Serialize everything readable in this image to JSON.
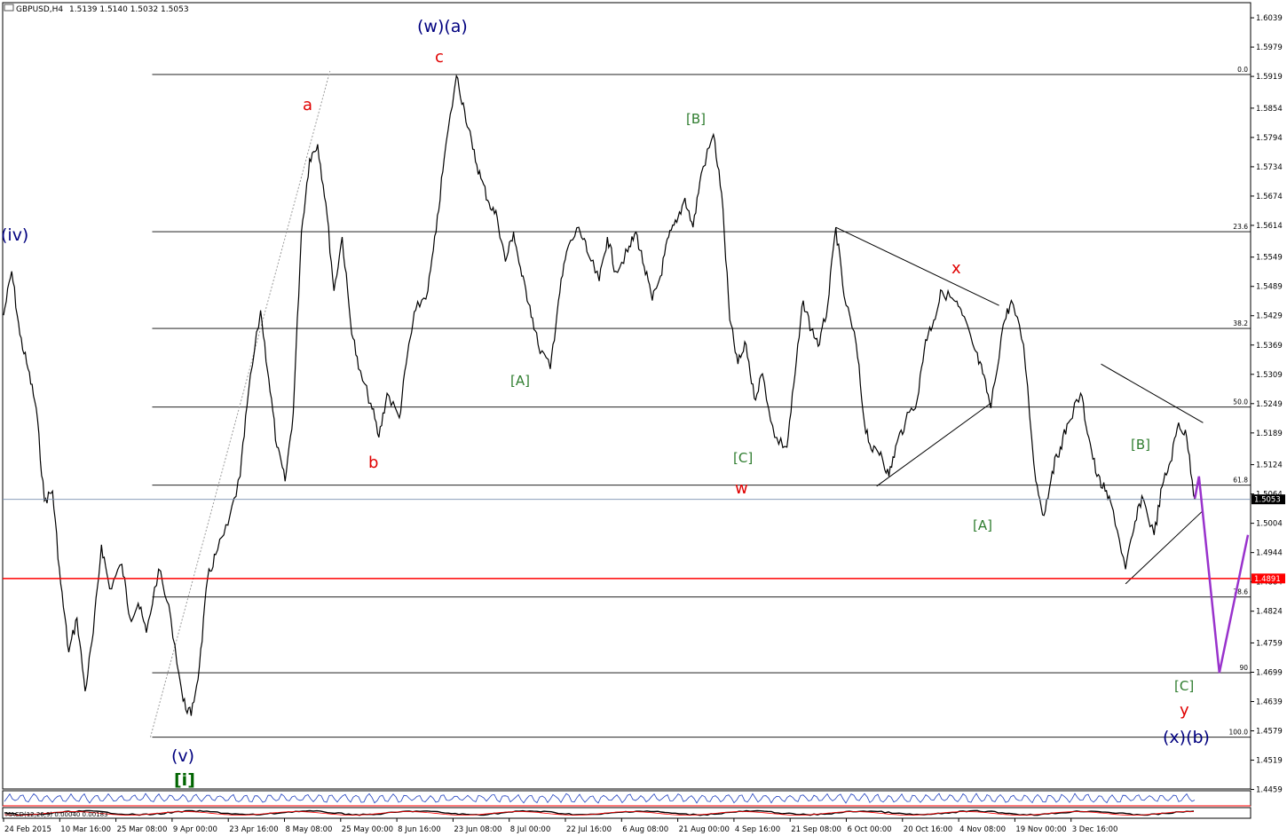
{
  "header": {
    "symbol": "GBPUSD,H4",
    "ohlc": "1.5139 1.5140 1.5032 1.5053"
  },
  "colors": {
    "price": "#000000",
    "projection": "#9932cc",
    "support": "#ff0000",
    "wave_blue": "#00007f",
    "wave_red": "#e00000",
    "wave_green": "#2f7d2f"
  },
  "chart_data": {
    "type": "line",
    "title": "GBPUSD,H4",
    "ylim": [
      1.446,
      1.607
    ],
    "y_ticks": [
      "1.6039",
      "1.5979",
      "1.5919",
      "1.5854",
      "1.5794",
      "1.5734",
      "1.5674",
      "1.5614",
      "1.5549",
      "1.5489",
      "1.5429",
      "1.5369",
      "1.5309",
      "1.5249",
      "1.5189",
      "1.5124",
      "1.5064",
      "1.5004",
      "1.4944",
      "1.4884",
      "1.4824",
      "1.4759",
      "1.4699",
      "1.4639",
      "1.4579",
      "1.4519",
      "1.4459"
    ],
    "x_ticks": [
      "24 Feb 2015",
      "10 Mar 16:00",
      "25 Mar 08:00",
      "9 Apr 00:00",
      "23 Apr 16:00",
      "8 May 08:00",
      "25 May 00:00",
      "8 Jun 16:00",
      "23 Jun 08:00",
      "8 Jul 00:00",
      "22 Jul 16:00",
      "6 Aug 08:00",
      "21 Aug 00:00",
      "4 Sep 16:00",
      "21 Sep 08:00",
      "6 Oct 00:00",
      "20 Oct 16:00",
      "4 Nov 08:00",
      "19 Nov 00:00",
      "3 Dec 16:00"
    ],
    "current_price": "1.5053",
    "support_price": "1.4891",
    "fib_levels": [
      {
        "label": "0.0",
        "price": 1.5923
      },
      {
        "label": "23.6",
        "price": 1.5601
      },
      {
        "label": "38.2",
        "price": 1.5403
      },
      {
        "label": "50.0",
        "price": 1.5242
      },
      {
        "label": "61.8",
        "price": 1.5082
      },
      {
        "label": "78.6",
        "price": 1.4853
      },
      {
        "label": "90",
        "price": 1.4698
      },
      {
        "label": "100.0",
        "price": 1.4566
      }
    ],
    "series": [
      {
        "values": [
          [
            "24 Feb 2015",
            1.543
          ],
          [
            "26 Feb",
            1.552
          ],
          [
            "28 Feb",
            1.539
          ],
          [
            "2 Mar",
            1.532
          ],
          [
            "4 Mar",
            1.524
          ],
          [
            "6 Mar",
            1.505
          ],
          [
            "8 Mar",
            1.507
          ],
          [
            "10 Mar",
            1.488
          ],
          [
            "12 Mar",
            1.474
          ],
          [
            "14 Mar",
            1.481
          ],
          [
            "16 Mar",
            1.466
          ],
          [
            "18 Mar",
            1.478
          ],
          [
            "20 Mar",
            1.496
          ],
          [
            "22 Mar",
            1.487
          ],
          [
            "25 Mar",
            1.492
          ],
          [
            "27 Mar",
            1.481
          ],
          [
            "29 Mar",
            1.484
          ],
          [
            "31 Mar",
            1.478
          ],
          [
            "3 Apr",
            1.491
          ],
          [
            "6 Apr",
            1.481
          ],
          [
            "9 Apr",
            1.464
          ],
          [
            "11 Apr",
            1.461
          ],
          [
            "13 Apr",
            1.471
          ],
          [
            "15 Apr",
            1.489
          ],
          [
            "17 Apr",
            1.494
          ],
          [
            "20 Apr",
            1.5
          ],
          [
            "23 Apr",
            1.51
          ],
          [
            "25 Apr",
            1.527
          ],
          [
            "28 Apr",
            1.544
          ],
          [
            "30 Apr",
            1.53
          ],
          [
            "2 May",
            1.516
          ],
          [
            "4 May",
            1.509
          ],
          [
            "6 May",
            1.523
          ],
          [
            "8 May",
            1.56
          ],
          [
            "10 May",
            1.575
          ],
          [
            "12 May",
            1.578
          ],
          [
            "14 May",
            1.566
          ],
          [
            "16 May",
            1.548
          ],
          [
            "18 May",
            1.559
          ],
          [
            "20 May",
            1.542
          ],
          [
            "22 May",
            1.532
          ],
          [
            "25 May",
            1.525
          ],
          [
            "27 May",
            1.518
          ],
          [
            "29 May",
            1.527
          ],
          [
            "1 Jun",
            1.522
          ],
          [
            "3 Jun",
            1.535
          ],
          [
            "5 Jun",
            1.544
          ],
          [
            "8 Jun",
            1.548
          ],
          [
            "10 Jun",
            1.56
          ],
          [
            "12 Jun",
            1.575
          ],
          [
            "15 Jun",
            1.592
          ],
          [
            "17 Jun",
            1.585
          ],
          [
            "19 Jun",
            1.577
          ],
          [
            "21 Jun",
            1.571
          ],
          [
            "23 Jun",
            1.566
          ],
          [
            "25 Jun",
            1.563
          ],
          [
            "27 Jun",
            1.554
          ],
          [
            "29 Jun",
            1.56
          ],
          [
            "1 Jul",
            1.551
          ],
          [
            "3 Jul",
            1.545
          ],
          [
            "5 Jul",
            1.537
          ],
          [
            "8 Jul",
            1.532
          ],
          [
            "10 Jul",
            1.546
          ],
          [
            "12 Jul",
            1.556
          ],
          [
            "15 Jul",
            1.561
          ],
          [
            "17 Jul",
            1.556
          ],
          [
            "20 Jul",
            1.55
          ],
          [
            "22 Jul",
            1.559
          ],
          [
            "24 Jul",
            1.552
          ],
          [
            "27 Jul",
            1.556
          ],
          [
            "29 Jul",
            1.56
          ],
          [
            "31 Jul",
            1.553
          ],
          [
            "2 Aug",
            1.546
          ],
          [
            "4 Aug",
            1.551
          ],
          [
            "6 Aug",
            1.559
          ],
          [
            "8 Aug",
            1.562
          ],
          [
            "10 Aug",
            1.567
          ],
          [
            "12 Aug",
            1.561
          ],
          [
            "14 Aug",
            1.572
          ],
          [
            "17 Aug",
            1.58
          ],
          [
            "19 Aug",
            1.568
          ],
          [
            "21 Aug",
            1.542
          ],
          [
            "23 Aug",
            1.533
          ],
          [
            "25 Aug",
            1.537
          ],
          [
            "27 Aug",
            1.526
          ],
          [
            "29 Aug",
            1.531
          ],
          [
            "1 Sep",
            1.518
          ],
          [
            "4 Sep",
            1.516
          ],
          [
            "6 Sep",
            1.531
          ],
          [
            "8 Sep",
            1.546
          ],
          [
            "10 Sep",
            1.54
          ],
          [
            "12 Sep",
            1.537
          ],
          [
            "14 Sep",
            1.545
          ],
          [
            "16 Sep",
            1.561
          ],
          [
            "18 Sep",
            1.547
          ],
          [
            "21 Sep",
            1.537
          ],
          [
            "23 Sep",
            1.521
          ],
          [
            "25 Sep",
            1.515
          ],
          [
            "27 Sep",
            1.515
          ],
          [
            "29 Sep",
            1.51
          ],
          [
            "1 Oct",
            1.517
          ],
          [
            "3 Oct",
            1.521
          ],
          [
            "6 Oct",
            1.526
          ],
          [
            "8 Oct",
            1.538
          ],
          [
            "10 Oct",
            1.542
          ],
          [
            "12 Oct",
            1.548
          ],
          [
            "15 Oct",
            1.546
          ],
          [
            "17 Oct",
            1.543
          ],
          [
            "20 Oct",
            1.536
          ],
          [
            "22 Oct",
            1.531
          ],
          [
            "24 Oct",
            1.524
          ],
          [
            "27 Oct",
            1.541
          ],
          [
            "29 Oct",
            1.546
          ],
          [
            "1 Nov",
            1.537
          ],
          [
            "4 Nov",
            1.509
          ],
          [
            "6 Nov",
            1.502
          ],
          [
            "8 Nov",
            1.511
          ],
          [
            "10 Nov",
            1.516
          ],
          [
            "12 Nov",
            1.521
          ],
          [
            "15 Nov",
            1.527
          ],
          [
            "17 Nov",
            1.518
          ],
          [
            "19 Nov",
            1.51
          ],
          [
            "21 Nov",
            1.507
          ],
          [
            "23 Nov",
            1.503
          ],
          [
            "26 Nov",
            1.491
          ],
          [
            "28 Nov",
            1.499
          ],
          [
            "30 Nov",
            1.506
          ],
          [
            "3 Dec",
            1.498
          ],
          [
            "5 Dec",
            1.508
          ],
          [
            "7 Dec",
            1.513
          ],
          [
            "9 Dec",
            1.521
          ],
          [
            "11 Dec",
            1.518
          ],
          [
            "13 Dec",
            1.5053
          ]
        ]
      }
    ],
    "projection": [
      [
        "13 Dec",
        1.5055
      ],
      [
        "14 Dec",
        1.51
      ],
      [
        "19 Dec",
        1.4698
      ],
      [
        "26 Dec",
        1.498
      ]
    ],
    "trendlines": [
      [
        [
          "1 Apr",
          1.4566
        ],
        [
          "15 May",
          1.593
        ]
      ],
      [
        [
          "16 Sep",
          1.561
        ],
        [
          "26 Oct",
          1.545
        ]
      ],
      [
        [
          "26 Sep",
          1.508
        ],
        [
          "24 Oct",
          1.525
        ]
      ],
      [
        [
          "20 Nov",
          1.533
        ],
        [
          "15 Dec",
          1.521
        ]
      ],
      [
        [
          "26 Nov",
          1.488
        ],
        [
          "15 Dec",
          1.503
        ]
      ]
    ]
  },
  "wave_labels": [
    {
      "text": "(w)(a)",
      "style": "blue"
    },
    {
      "text": "c",
      "style": "red"
    },
    {
      "text": "a",
      "style": "red"
    },
    {
      "text": "b",
      "style": "red"
    },
    {
      "text": "(iv)",
      "style": "blue"
    },
    {
      "text": "(v)",
      "style": "blue"
    },
    {
      "text": "[i]",
      "style": "green-big"
    },
    {
      "text": "[B]",
      "style": "green"
    },
    {
      "text": "[A]",
      "style": "green"
    },
    {
      "text": "[C]",
      "style": "green"
    },
    {
      "text": "w",
      "style": "red"
    },
    {
      "text": "x",
      "style": "red"
    },
    {
      "text": "[A]",
      "style": "green"
    },
    {
      "text": "[B]",
      "style": "green"
    },
    {
      "text": "[C]",
      "style": "green"
    },
    {
      "text": "y",
      "style": "red"
    },
    {
      "text": "(x)(b)",
      "style": "blue"
    }
  ],
  "indicators": {
    "macd": "MACD(12,26,9) 0.00040 0.00183"
  }
}
